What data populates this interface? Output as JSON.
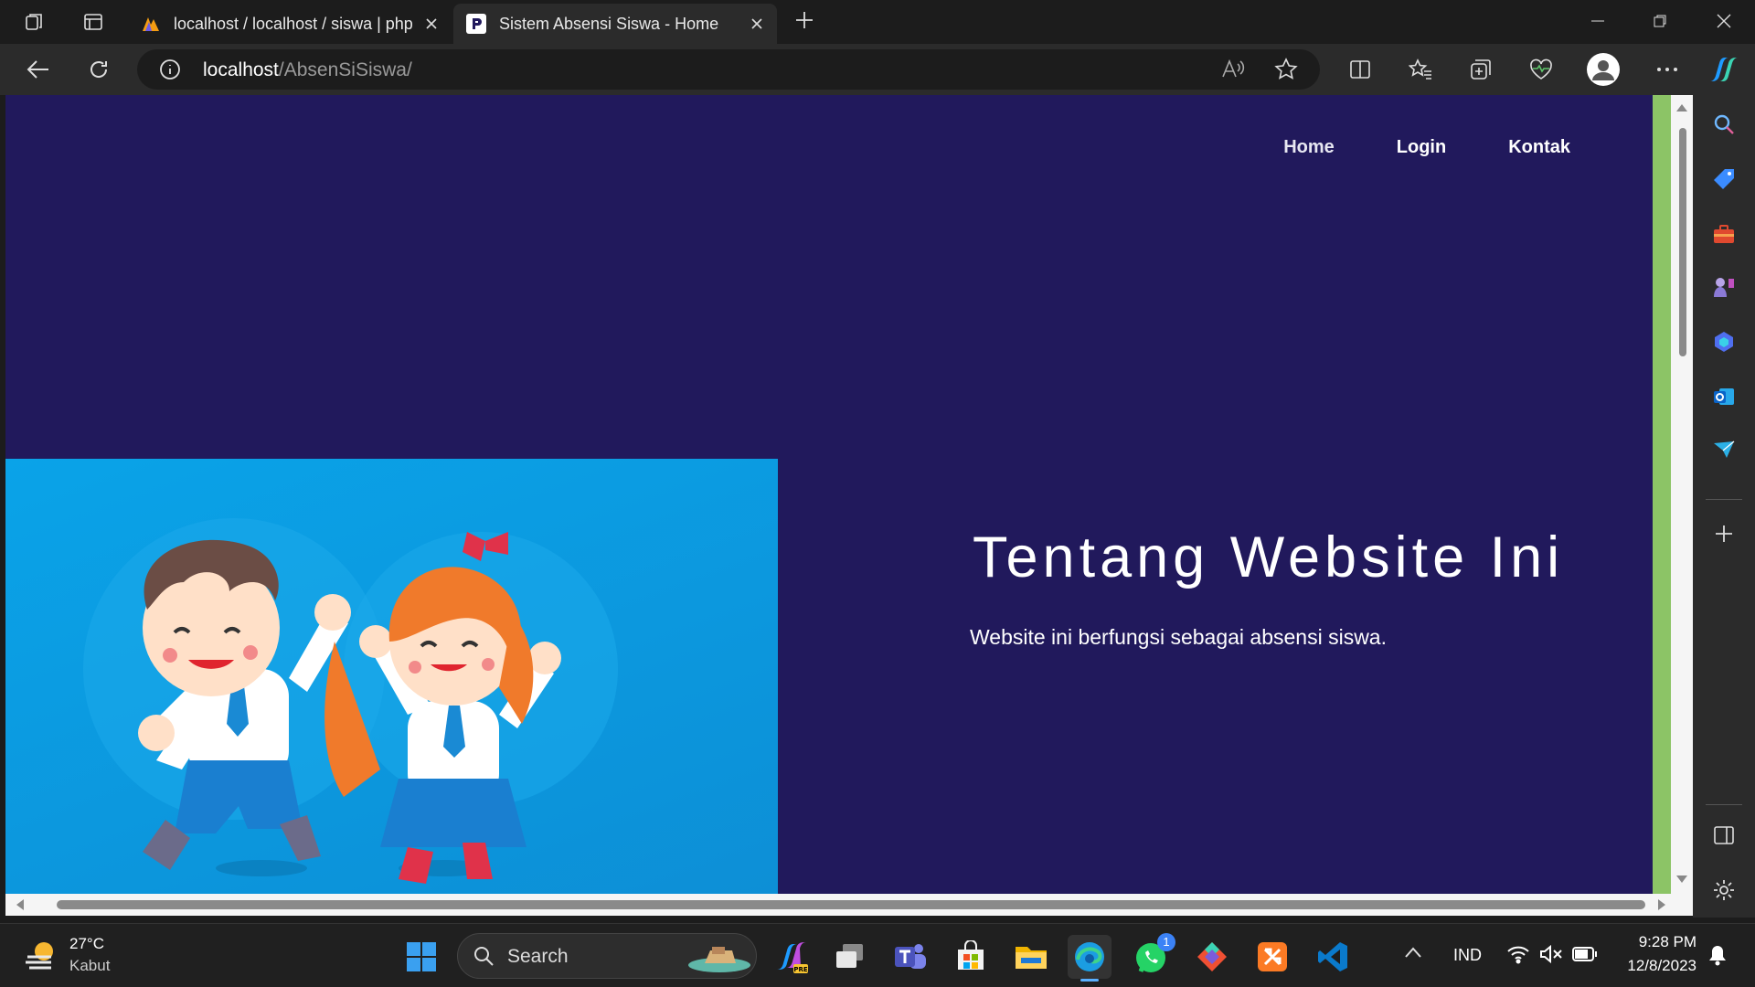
{
  "browser": {
    "tabs": [
      {
        "title": "localhost / localhost / siswa | php",
        "active": false
      },
      {
        "title": "Sistem Absensi Siswa - Home",
        "active": true
      }
    ],
    "address": {
      "host": "localhost",
      "path": "/AbsenSiSiswa/"
    }
  },
  "site": {
    "nav": [
      "Home",
      "Login",
      "Kontak"
    ],
    "about_title": "Tentang Website Ini",
    "about_text": "Website ini berfungsi sebagai absensi siswa.",
    "colors": {
      "background": "#21195c",
      "hero": "#0aa3e8",
      "accent_bar": "#8cc466"
    }
  },
  "taskbar": {
    "weather": {
      "temp": "27°C",
      "desc": "Kabut"
    },
    "search": "Search",
    "whatsapp_badge": "1",
    "language": "IND",
    "time": "9:28 PM",
    "date": "12/8/2023"
  },
  "icons": [
    "workspaces-icon",
    "tab-actions-icon",
    "back-icon",
    "refresh-icon",
    "info-icon",
    "read-aloud-icon",
    "favorite-star-icon",
    "split-screen-icon",
    "favorites-icon",
    "collections-icon",
    "browser-essentials-icon",
    "profile-icon",
    "more-icon",
    "copilot-icon",
    "search-icon",
    "shopping-icon",
    "tools-icon",
    "games-icon",
    "microsoft365-icon",
    "outlook-icon",
    "drop-icon",
    "add-icon",
    "sidebar-toggle-icon",
    "settings-icon"
  ]
}
